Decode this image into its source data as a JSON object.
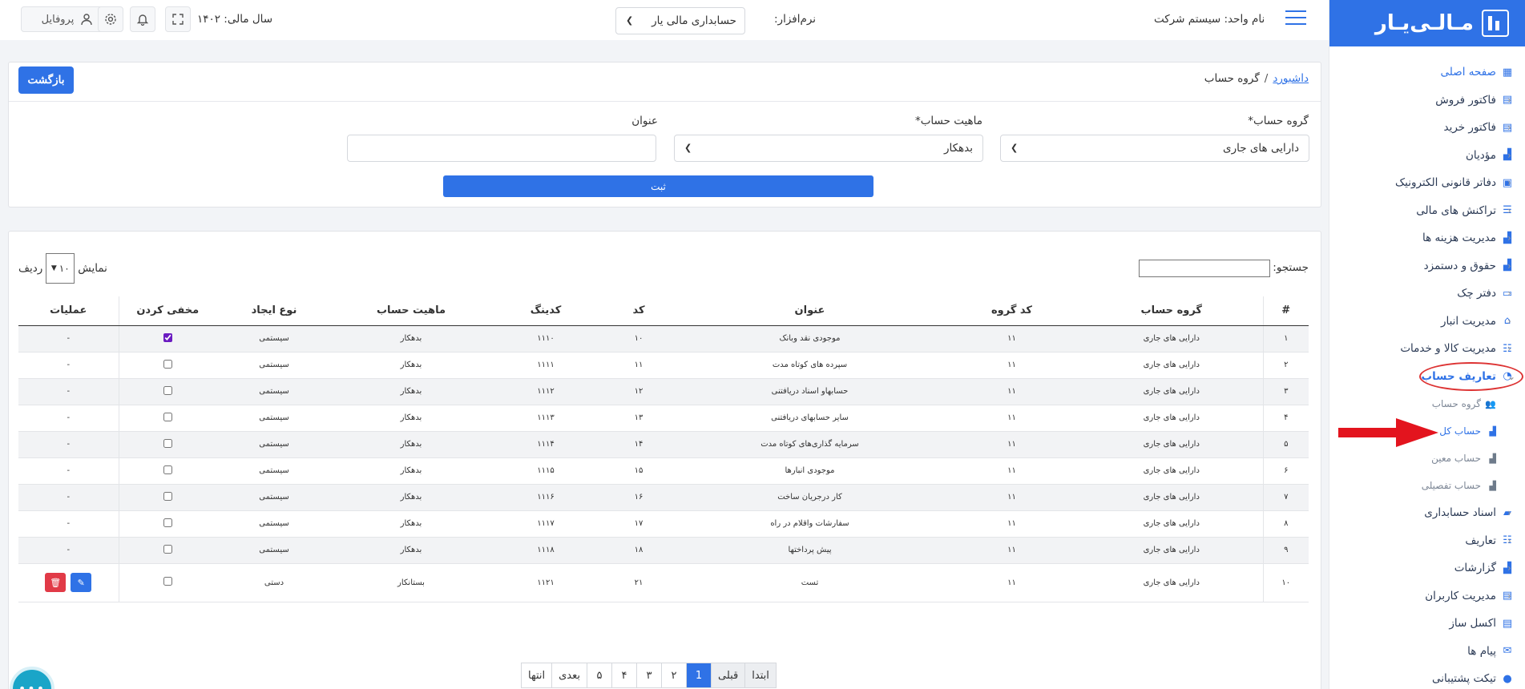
{
  "sidebar": {
    "logo_text": "مـالـی‌یـار",
    "items": [
      {
        "label": "صفحه اصلی",
        "icon": "grid-icon"
      },
      {
        "label": "فاکتور فروش",
        "icon": "invoice-icon"
      },
      {
        "label": "فاکتور خرید",
        "icon": "invoice-icon"
      },
      {
        "label": "مؤدیان",
        "icon": "chart-icon"
      },
      {
        "label": "دفاتر قانونی الکترونیک",
        "icon": "book-icon"
      },
      {
        "label": "تراکنش های مالی",
        "icon": "coins-icon"
      },
      {
        "label": "مدیریت هزینه ها",
        "icon": "chart-icon"
      },
      {
        "label": "حقوق و دستمزد",
        "icon": "chart-icon"
      },
      {
        "label": "دفتر چک",
        "icon": "money-icon"
      },
      {
        "label": "مدیریت انبار",
        "icon": "warehouse-icon"
      },
      {
        "label": "مدیریت کالا و خدمات",
        "icon": "list-icon"
      },
      {
        "label": "تعاریف حساب",
        "icon": "pie-icon"
      }
    ],
    "sub_items": [
      {
        "label": "گروه حساب",
        "icon": "users-icon"
      },
      {
        "label": "حساب کل",
        "icon": "chart-icon"
      },
      {
        "label": "حساب معین",
        "icon": "chart-icon"
      },
      {
        "label": "حساب تفصیلی",
        "icon": "chart-icon"
      }
    ],
    "items_after": [
      {
        "label": "اسناد حسابداری",
        "icon": "folder-icon"
      },
      {
        "label": "تعاریف",
        "icon": "list-icon"
      },
      {
        "label": "گزارشات",
        "icon": "chart-icon"
      },
      {
        "label": "مدیریت کاربران",
        "icon": "invoice-icon"
      },
      {
        "label": "اکسل ساز",
        "icon": "excel-icon"
      },
      {
        "label": "پیام ها",
        "icon": "mail-icon"
      },
      {
        "label": "تیکت پشتیبانی",
        "icon": "comment-icon"
      }
    ]
  },
  "header": {
    "unit_name": "نام واحد: سیستم شرکت",
    "software_label": "نرم‌افزار:",
    "software_value": "حسابداری مالی یار",
    "fiscal_year": "سال مالی: ۱۴۰۲",
    "profile_label": "پروفایل"
  },
  "form": {
    "breadcrumb_home": "داشبورد",
    "breadcrumb_sep": "/",
    "breadcrumb_current": "گروه حساب",
    "back_label": "بازگشت",
    "group_label": "گروه حساب*",
    "group_value": "دارایی های جاری",
    "nature_label": "ماهیت حساب*",
    "nature_value": "بدهکار",
    "title_label": "عنوان",
    "title_value": "",
    "submit_label": "ثبت"
  },
  "table": {
    "search_label": "جستجو:",
    "show_label": "نمایش",
    "show_value": "۱۰",
    "rows_label": "ردیف",
    "headers": [
      "#",
      "گروه حساب",
      "کد گروه",
      "عنوان",
      "کد",
      "کدینگ",
      "ماهیت حساب",
      "نوع ایجاد",
      "مخفی کردن",
      "عملیات"
    ],
    "rows": [
      {
        "num": "۱",
        "group": "دارایی های جاری",
        "group_code": "۱۱",
        "title": "موجودی نقد وبانک",
        "code": "۱۰",
        "coding": "۱۱۱۰",
        "nature": "بدهکار",
        "creation": "سیستمی",
        "hidden": true,
        "ops": "-"
      },
      {
        "num": "۲",
        "group": "دارایی های جاری",
        "group_code": "۱۱",
        "title": "سپرده های کوتاه مدت",
        "code": "۱۱",
        "coding": "۱۱۱۱",
        "nature": "بدهکار",
        "creation": "سیستمی",
        "hidden": false,
        "ops": "-"
      },
      {
        "num": "۳",
        "group": "دارایی های جاری",
        "group_code": "۱۱",
        "title": "حسابهاو اسناد دریافتنی",
        "code": "۱۲",
        "coding": "۱۱۱۲",
        "nature": "بدهکار",
        "creation": "سیستمی",
        "hidden": false,
        "ops": "-"
      },
      {
        "num": "۴",
        "group": "دارایی های جاری",
        "group_code": "۱۱",
        "title": "سایر حسابهای دریافتنی",
        "code": "۱۳",
        "coding": "۱۱۱۳",
        "nature": "بدهکار",
        "creation": "سیستمی",
        "hidden": false,
        "ops": "-"
      },
      {
        "num": "۵",
        "group": "دارایی های جاری",
        "group_code": "۱۱",
        "title": "سرمایه گذاری‌های کوتاه مدت",
        "code": "۱۴",
        "coding": "۱۱۱۴",
        "nature": "بدهکار",
        "creation": "سیستمی",
        "hidden": false,
        "ops": "-"
      },
      {
        "num": "۶",
        "group": "دارایی های جاری",
        "group_code": "۱۱",
        "title": "موجودی انبارها",
        "code": "۱۵",
        "coding": "۱۱۱۵",
        "nature": "بدهکار",
        "creation": "سیستمی",
        "hidden": false,
        "ops": "-"
      },
      {
        "num": "۷",
        "group": "دارایی های جاری",
        "group_code": "۱۱",
        "title": "کار درجریان ساخت",
        "code": "۱۶",
        "coding": "۱۱۱۶",
        "nature": "بدهکار",
        "creation": "سیستمی",
        "hidden": false,
        "ops": "-"
      },
      {
        "num": "۸",
        "group": "دارایی های جاری",
        "group_code": "۱۱",
        "title": "سفارشات واقلام در راه",
        "code": "۱۷",
        "coding": "۱۱۱۷",
        "nature": "بدهکار",
        "creation": "سیستمی",
        "hidden": false,
        "ops": "-"
      },
      {
        "num": "۹",
        "group": "دارایی های جاری",
        "group_code": "۱۱",
        "title": "پیش پرداختها",
        "code": "۱۸",
        "coding": "۱۱۱۸",
        "nature": "بدهکار",
        "creation": "سیستمی",
        "hidden": false,
        "ops": "-"
      },
      {
        "num": "۱۰",
        "group": "دارایی های جاری",
        "group_code": "۱۱",
        "title": "تست",
        "code": "۲۱",
        "coding": "۱۱۲۱",
        "nature": "بستانکار",
        "creation": "دستی",
        "hidden": false,
        "ops": ""
      }
    ]
  },
  "pagination": {
    "first": "ابتدا",
    "prev": "قبلی",
    "pages": [
      "1",
      "۲",
      "۳",
      "۴",
      "۵"
    ],
    "next": "بعدی",
    "last": "انتها"
  },
  "colors": {
    "accent": "#2f72e6",
    "danger": "#e13a47",
    "annotation": "#dd2222"
  }
}
